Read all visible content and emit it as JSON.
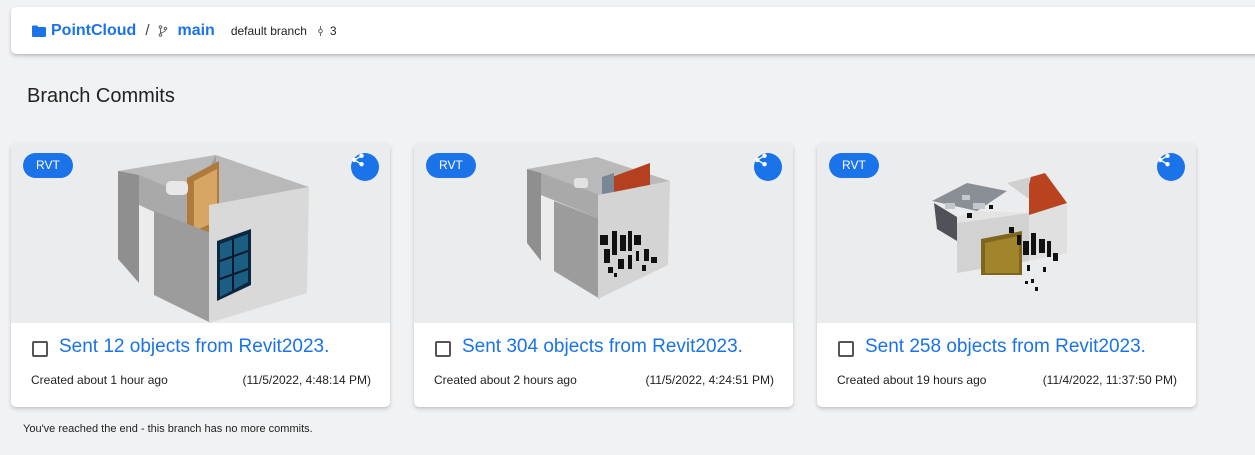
{
  "header": {
    "stream_name": "PointCloud",
    "separator": "/",
    "branch_name": "main",
    "branch_description": "default branch",
    "commit_count": "3"
  },
  "page_title": "Branch Commits",
  "colors": {
    "accent": "#1a73e8",
    "background": "#f1f2f4"
  },
  "commits": [
    {
      "badge": "RVT",
      "message": "Sent 12 objects from Revit2023.",
      "created": "Created about 1 hour ago",
      "date": "(11/5/2022, 4:48:14 PM)"
    },
    {
      "badge": "RVT",
      "message": "Sent 304 objects from Revit2023.",
      "created": "Created about 2 hours ago",
      "date": "(11/5/2022, 4:24:51 PM)"
    },
    {
      "badge": "RVT",
      "message": "Sent 258 objects from Revit2023.",
      "created": "Created about 19 hours ago",
      "date": "(11/4/2022, 11:37:50 PM)"
    }
  ],
  "end_note": "You've reached the end - this branch has no more commits."
}
